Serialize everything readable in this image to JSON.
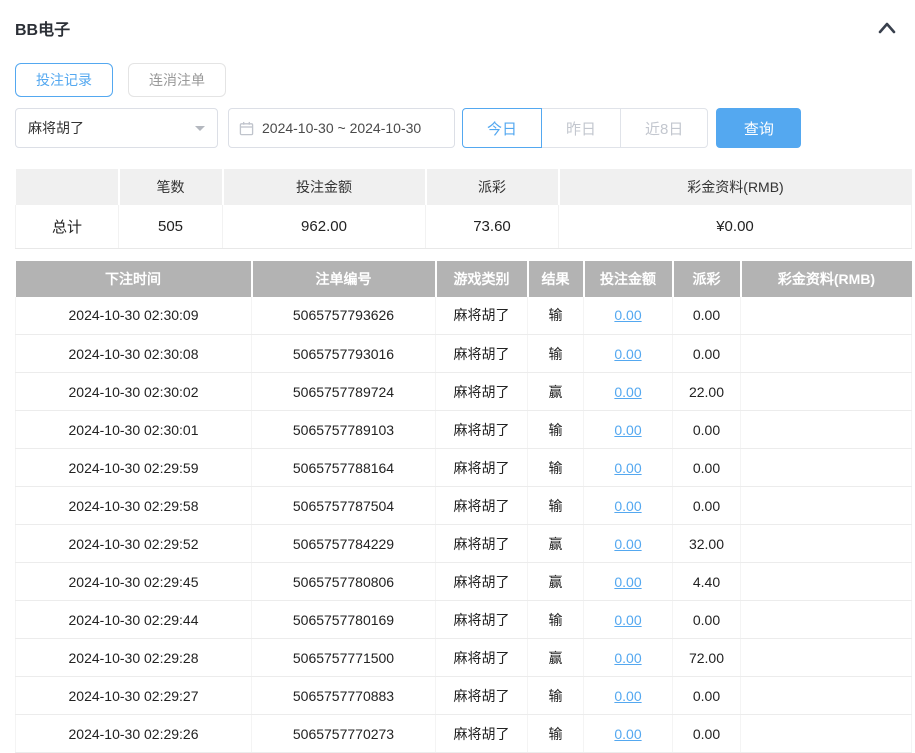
{
  "colors": {
    "accent": "#54a8f0",
    "records_header_bg": "#b3b3b3",
    "summary_header_bg": "#f0f0f0"
  },
  "header": {
    "title": "BB电子"
  },
  "tabs": [
    {
      "label": "投注记录",
      "active": true
    },
    {
      "label": "连消注单",
      "active": false
    }
  ],
  "filters": {
    "game_select": {
      "value": "麻将胡了"
    },
    "date_range": {
      "value": "2024-10-30 ~ 2024-10-30"
    },
    "quick_buttons": [
      {
        "label": "今日",
        "active": true
      },
      {
        "label": "昨日",
        "active": false
      },
      {
        "label": "近8日",
        "active": false
      }
    ],
    "query_label": "查询"
  },
  "summary_table": {
    "headers": [
      "",
      "笔数",
      "投注金额",
      "派彩",
      "彩金资料(RMB)"
    ],
    "row": {
      "label": "总计",
      "count": "505",
      "bet_amount": "962.00",
      "payout": "73.60",
      "jackpot": "¥0.00"
    }
  },
  "records_table": {
    "headers": [
      "下注时间",
      "注单编号",
      "游戏类别",
      "结果",
      "投注金额",
      "派彩",
      "彩金资料(RMB)"
    ],
    "rows": [
      {
        "time": "2024-10-30 02:30:09",
        "order_no": "5065757793626",
        "game": "麻将胡了",
        "result": "输",
        "bet_amount": "0.00",
        "payout": "0.00",
        "jackpot": ""
      },
      {
        "time": "2024-10-30 02:30:08",
        "order_no": "5065757793016",
        "game": "麻将胡了",
        "result": "输",
        "bet_amount": "0.00",
        "payout": "0.00",
        "jackpot": ""
      },
      {
        "time": "2024-10-30 02:30:02",
        "order_no": "5065757789724",
        "game": "麻将胡了",
        "result": "赢",
        "bet_amount": "0.00",
        "payout": "22.00",
        "jackpot": ""
      },
      {
        "time": "2024-10-30 02:30:01",
        "order_no": "5065757789103",
        "game": "麻将胡了",
        "result": "输",
        "bet_amount": "0.00",
        "payout": "0.00",
        "jackpot": ""
      },
      {
        "time": "2024-10-30 02:29:59",
        "order_no": "5065757788164",
        "game": "麻将胡了",
        "result": "输",
        "bet_amount": "0.00",
        "payout": "0.00",
        "jackpot": ""
      },
      {
        "time": "2024-10-30 02:29:58",
        "order_no": "5065757787504",
        "game": "麻将胡了",
        "result": "输",
        "bet_amount": "0.00",
        "payout": "0.00",
        "jackpot": ""
      },
      {
        "time": "2024-10-30 02:29:52",
        "order_no": "5065757784229",
        "game": "麻将胡了",
        "result": "赢",
        "bet_amount": "0.00",
        "payout": "32.00",
        "jackpot": ""
      },
      {
        "time": "2024-10-30 02:29:45",
        "order_no": "5065757780806",
        "game": "麻将胡了",
        "result": "赢",
        "bet_amount": "0.00",
        "payout": "4.40",
        "jackpot": ""
      },
      {
        "time": "2024-10-30 02:29:44",
        "order_no": "5065757780169",
        "game": "麻将胡了",
        "result": "输",
        "bet_amount": "0.00",
        "payout": "0.00",
        "jackpot": ""
      },
      {
        "time": "2024-10-30 02:29:28",
        "order_no": "5065757771500",
        "game": "麻将胡了",
        "result": "赢",
        "bet_amount": "0.00",
        "payout": "72.00",
        "jackpot": ""
      },
      {
        "time": "2024-10-30 02:29:27",
        "order_no": "5065757770883",
        "game": "麻将胡了",
        "result": "输",
        "bet_amount": "0.00",
        "payout": "0.00",
        "jackpot": ""
      },
      {
        "time": "2024-10-30 02:29:26",
        "order_no": "5065757770273",
        "game": "麻将胡了",
        "result": "输",
        "bet_amount": "0.00",
        "payout": "0.00",
        "jackpot": ""
      }
    ]
  }
}
